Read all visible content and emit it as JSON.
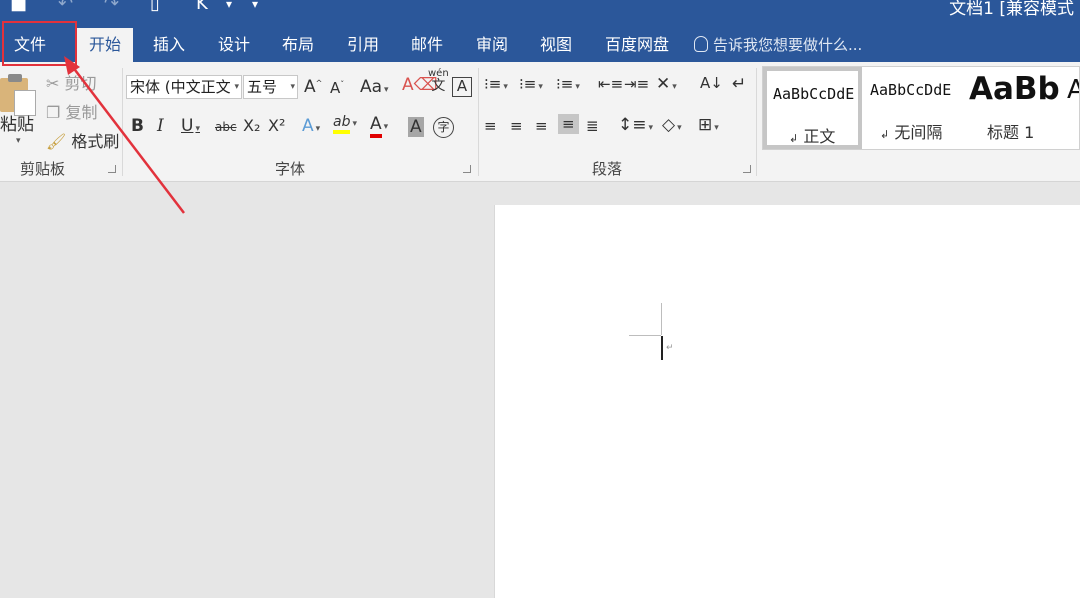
{
  "window": {
    "title": "文档1 [兼容模式"
  },
  "tabs": [
    {
      "label": "文件"
    },
    {
      "label": "开始"
    },
    {
      "label": "插入"
    },
    {
      "label": "设计"
    },
    {
      "label": "布局"
    },
    {
      "label": "引用"
    },
    {
      "label": "邮件"
    },
    {
      "label": "审阅"
    },
    {
      "label": "视图"
    },
    {
      "label": "百度网盘"
    }
  ],
  "active_tab": "开始",
  "highlighted_tab": "文件",
  "tell_me": {
    "placeholder": "告诉我您想要做什么..."
  },
  "clipboard": {
    "paste": "粘贴",
    "cut": "剪切",
    "copy": "复制",
    "format_painter": "格式刷",
    "label": "剪贴板"
  },
  "font": {
    "name": "宋体 (中文正文",
    "size": "五号",
    "label": "字体",
    "grow": "A",
    "shrink": "A",
    "case": "Aa",
    "phonetic_top": "wén",
    "phonetic_bottom": "文",
    "border_char": "A",
    "bold": "B",
    "italic": "I",
    "underline": "U",
    "strike": "abc",
    "subscript": "X₂",
    "superscript": "X²",
    "effects": "A",
    "highlight": "ab",
    "font_color": "A",
    "char_shading": "A",
    "enclose": "字"
  },
  "paragraph": {
    "label": "段落"
  },
  "styles": [
    {
      "sample": "AaBbCcDdE",
      "name": "正文"
    },
    {
      "sample": "AaBbCcDdE",
      "name": "无间隔"
    },
    {
      "sample": "AaBb",
      "name": "标题 1"
    },
    {
      "sample": "A",
      "name": ""
    }
  ],
  "colors": {
    "ribbon_blue": "#2b579a",
    "highlight_red": "#e2323c",
    "highlight_yellow": "#ffff00",
    "font_red": "#e00000"
  },
  "icons": [
    "save-icon",
    "undo-icon",
    "redo-icon",
    "lightbulb-icon",
    "clipboard-icon",
    "scissors-icon",
    "copy-icon",
    "paintbrush-icon"
  ]
}
